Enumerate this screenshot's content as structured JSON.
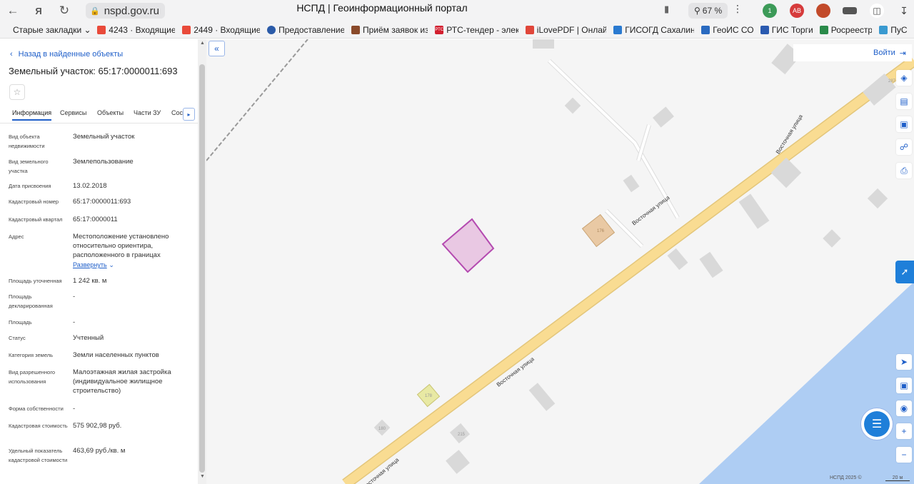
{
  "browser": {
    "url": "nspd.gov.ru",
    "title": "НСПД | Геоинформационный портал",
    "zoom": "67 %"
  },
  "bookmarks": [
    {
      "label": "Старые закладки",
      "color": "#ffffff"
    },
    {
      "label": "4243 · Входящие",
      "color": "#e94a3a"
    },
    {
      "label": "2449 · Входящие",
      "color": "#e94a3a"
    },
    {
      "label": "Предоставление",
      "color": "#2a5aa8"
    },
    {
      "label": "Приём заявок из",
      "color": "#8a4a2a"
    },
    {
      "label": "РТС-тендер - элек",
      "color": "#d21f2f"
    },
    {
      "label": "iLovePDF | Онлай",
      "color": "#e0463a"
    },
    {
      "label": "ГИСОГД Сахалин",
      "color": "#2a7ad0"
    },
    {
      "label": "ГеоИС СО",
      "color": "#2a6ac0"
    },
    {
      "label": "ГИС Торги",
      "color": "#2a5ab0"
    },
    {
      "label": "Росреестр",
      "color": "#2a8a4a"
    },
    {
      "label": "ПуС",
      "color": "#3a9ad0"
    }
  ],
  "side": {
    "back": "Назад в найденные объекты",
    "title": "Земельный участок: 65:17:0000011:693",
    "tabs": [
      "Информация",
      "Сервисы",
      "Объекты",
      "Части ЗУ",
      "Сос"
    ],
    "expand_label": "Развернуть",
    "rows": [
      {
        "k": "Вид объекта недвижимости",
        "v": "Земельный участок"
      },
      {
        "k": "Вид земельного участка",
        "v": "Землепользование"
      },
      {
        "k": "Дата присвоения",
        "v": "13.02.2018"
      },
      {
        "k": "Кадастровый номер",
        "v": "65:17:0000011:693"
      },
      {
        "k": "Кадастровый квартал",
        "v": "65:17:0000011"
      },
      {
        "k": "Адрес",
        "v": "Местоположение установлено относительно ориентира, расположенного в границах"
      },
      {
        "k": "Площадь уточненная",
        "v": "1 242 кв. м"
      },
      {
        "k": "Площадь декларированная",
        "v": "-"
      },
      {
        "k": "Площадь",
        "v": "-"
      },
      {
        "k": "Статус",
        "v": "Учтенный"
      },
      {
        "k": "Категория земель",
        "v": "Земли населенных пунктов"
      },
      {
        "k": "Вид разрешенного использования",
        "v": "Малоэтажная жилая застройка (индивидуальное жилищное строительство)"
      },
      {
        "k": "Форма собственности",
        "v": "-"
      },
      {
        "k": "Кадастровая стоимость",
        "v": "575 902,98 руб."
      },
      {
        "k": "Удельный показатель кадастровой стоимости",
        "v": "463,69 руб./кв. м"
      }
    ]
  },
  "map": {
    "login": "Войти",
    "street1": "Восточная улица",
    "street2": "Восточная улица",
    "street3": "Восточная улица",
    "street4": "Восточная улица",
    "lbl_176": "176",
    "lbl_178": "178",
    "lbl_180": "180",
    "lbl_215": "215",
    "lbl_287": "287",
    "footer": "НСПД 2025 ©",
    "scale": "20 м"
  }
}
